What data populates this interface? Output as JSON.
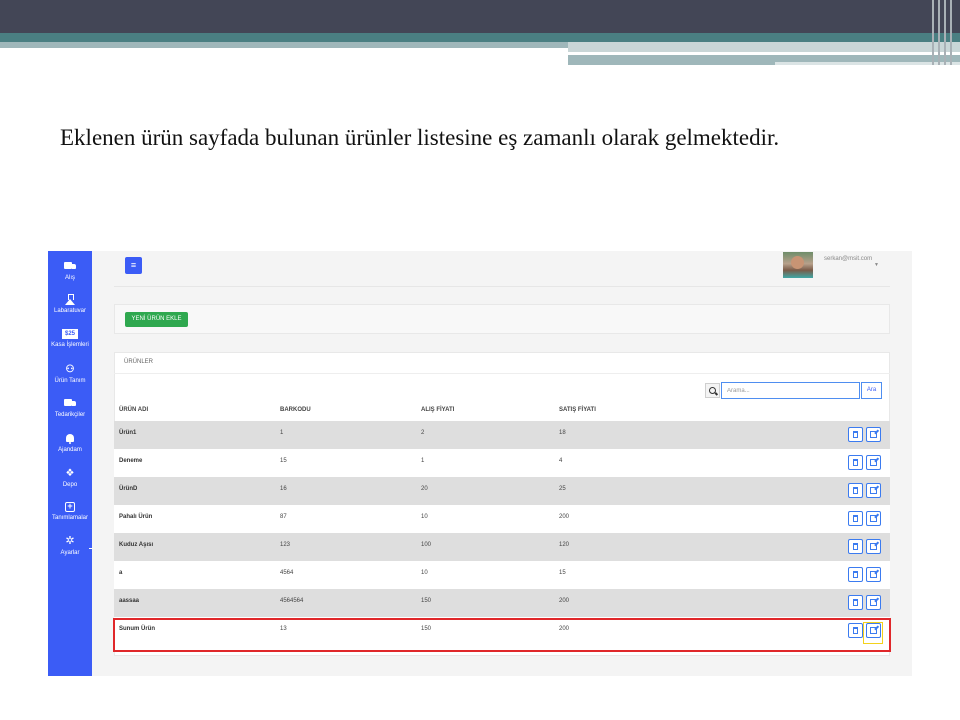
{
  "slide": {
    "caption": "Eklenen ürün sayfada bulunan ürünler listesine eş zamanlı olarak gelmektedir."
  },
  "sidebar": {
    "items": [
      {
        "label": "Alış",
        "icon": "truck-icon"
      },
      {
        "label": "Labaratuvar",
        "icon": "flask-icon"
      },
      {
        "label": "Kasa İşlemleri",
        "icon": "money-icon",
        "icon_text": "$25"
      },
      {
        "label": "Ürün Tanım",
        "icon": "people-icon"
      },
      {
        "label": "Tedarikçiler",
        "icon": "truck-icon"
      },
      {
        "label": "Ajandam",
        "icon": "bell-icon"
      },
      {
        "label": "Depo",
        "icon": "dropbox-icon"
      },
      {
        "label": "Tanımlamalar",
        "icon": "plus-square-icon"
      },
      {
        "label": "Ayarlar",
        "icon": "gear-icon"
      }
    ]
  },
  "header": {
    "menu_icon": "hamburger-icon",
    "user_email": "serkan@msit.com"
  },
  "toolbar": {
    "add_product_label": "YENİ ÜRÜN EKLE"
  },
  "products": {
    "panel_title": "ÜRÜNLER",
    "search": {
      "placeholder": "Arama...",
      "button_label": "Ara"
    },
    "columns": [
      "ÜRÜN ADI",
      "BARKODU",
      "ALIŞ FİYATI",
      "SATIŞ FİYATI"
    ],
    "rows": [
      {
        "name": "Ürün1",
        "barcode": "1",
        "buy_price": "2",
        "sell_price": "18"
      },
      {
        "name": "Deneme",
        "barcode": "15",
        "buy_price": "1",
        "sell_price": "4"
      },
      {
        "name": "ÜrünD",
        "barcode": "16",
        "buy_price": "20",
        "sell_price": "25"
      },
      {
        "name": "Pahalı Ürün",
        "barcode": "87",
        "buy_price": "10",
        "sell_price": "200"
      },
      {
        "name": "Kuduz Aşısı",
        "barcode": "123",
        "buy_price": "100",
        "sell_price": "120"
      },
      {
        "name": "a",
        "barcode": "4564",
        "buy_price": "10",
        "sell_price": "15"
      },
      {
        "name": "aassaa",
        "barcode": "4564564",
        "buy_price": "150",
        "sell_price": "200"
      },
      {
        "name": "Sunum Ürün",
        "barcode": "13",
        "buy_price": "150",
        "sell_price": "200"
      }
    ],
    "highlight_color": "#e0272a",
    "edit_highlight_color": "#f3d21b"
  },
  "colors": {
    "sidebar": "#3b5cf6",
    "add_button": "#2fa84f",
    "slide_header": "#434656",
    "slide_band": "#4a7f82"
  }
}
